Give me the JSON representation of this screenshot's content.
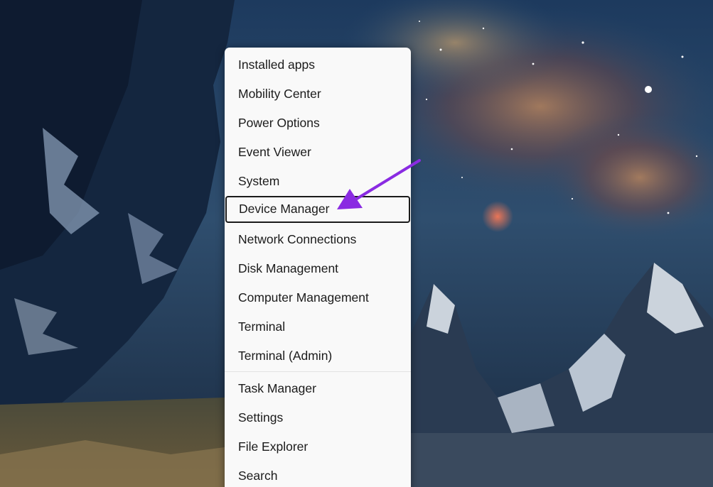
{
  "menu": {
    "items": [
      {
        "label": "Installed apps"
      },
      {
        "label": "Mobility Center"
      },
      {
        "label": "Power Options"
      },
      {
        "label": "Event Viewer"
      },
      {
        "label": "System"
      },
      {
        "label": "Device Manager"
      },
      {
        "label": "Network Connections"
      },
      {
        "label": "Disk Management"
      },
      {
        "label": "Computer Management"
      },
      {
        "label": "Terminal"
      },
      {
        "label": "Terminal (Admin)"
      },
      {
        "label": "Task Manager"
      },
      {
        "label": "Settings"
      },
      {
        "label": "File Explorer"
      },
      {
        "label": "Search"
      }
    ],
    "highlighted_item": "Device Manager"
  },
  "annotation": {
    "arrow_color": "#8a2be2",
    "points_to": "Device Manager"
  },
  "colors": {
    "menu_background": "#f9f9f9",
    "menu_text": "#1b1b1b",
    "highlight_border": "#1a1a1a"
  }
}
